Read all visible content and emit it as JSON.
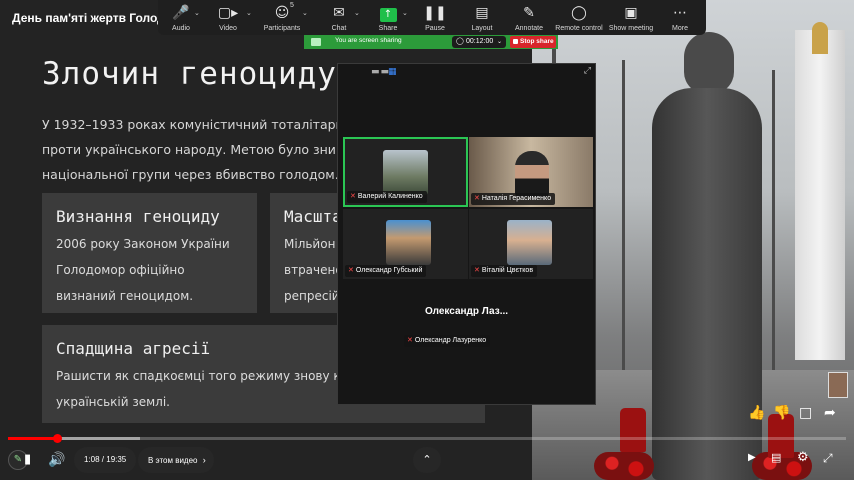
{
  "video": {
    "title": "День пам'яті жертв Голодо",
    "slide": {
      "heading": "Злочин геноциду",
      "intro": "У 1932–1933 роках комуністичний тоталітарний р\nпроти українського народу. Метою було знищен\nнаціональної групи через вбивство голодом.",
      "cards": [
        {
          "title": "Визнання геноциду",
          "body": "2006 року Законом України\nГолодомор офіційно\nвизнаний геноцидом."
        },
        {
          "title": "Масштаб",
          "body": "Мільйон\nвтрачено\nрепресій"
        },
        {
          "title": "Спадщина агресії",
          "body": "Рашисти як спадкоємці того режиму знову коя\nукраїнській землі."
        }
      ]
    }
  },
  "zoom": {
    "toolbar": {
      "audio": "Audio",
      "video": "Video",
      "participants": "Participants",
      "participants_count": "5",
      "chat": "Chat",
      "share": "Share",
      "pause": "Pause",
      "layout": "Layout",
      "annotate": "Annotate",
      "remote": "Remote control",
      "show_meeting": "Show meeting",
      "more": "More"
    },
    "sharing": {
      "status": "You are screen sharing",
      "timer": "00:12:00",
      "stop": "Stop share"
    },
    "participants": [
      {
        "name": "Валерий Калиненко",
        "active": true
      },
      {
        "name": "Наталія Герасименко",
        "active": false
      },
      {
        "name": "Олександр Губський",
        "active": false
      },
      {
        "name": "Віталій Цвєтков",
        "active": false
      },
      {
        "name": "Олександр Лазуренко",
        "active": false
      }
    ],
    "big_name": "Олександр  Лаз..."
  },
  "player": {
    "time": "1:08 / 19:35",
    "progress": 0.058,
    "buffered": 0.157,
    "chapter": "В этом видео"
  },
  "colors": {
    "accent_green": "#2bc654",
    "stop_red": "#d8262b",
    "yt_red": "#ff0000"
  }
}
